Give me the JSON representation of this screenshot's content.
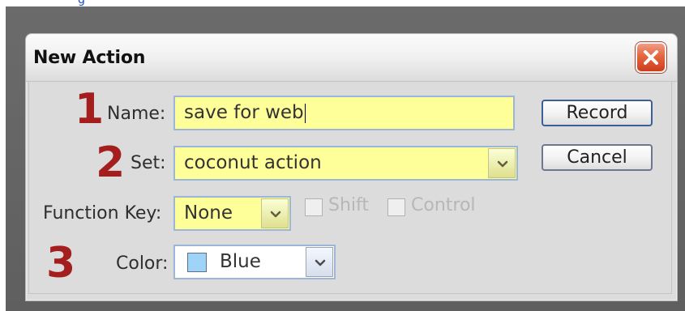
{
  "top_link": {
    "text": "g"
  },
  "dialog": {
    "title": "New Action",
    "close_icon": "close-icon"
  },
  "annotations": {
    "step_1": "1",
    "step_2": "2",
    "step_3": "3"
  },
  "form": {
    "name_label": "Name:",
    "name_value": "save for web",
    "set_label": "Set:",
    "set_value": "coconut action",
    "function_key_label": "Function Key:",
    "function_key_value": "None",
    "shift_label": "Shift",
    "control_label": "Control",
    "color_label": "Color:",
    "color_value": "Blue",
    "color_swatch": "#9fd3f7"
  },
  "buttons": {
    "record": "Record",
    "cancel": "Cancel"
  },
  "theme": {
    "annotation_red": "#a51e1e",
    "field_yellow": "#ffff99",
    "field_border_blue": "#9bb6d8"
  }
}
